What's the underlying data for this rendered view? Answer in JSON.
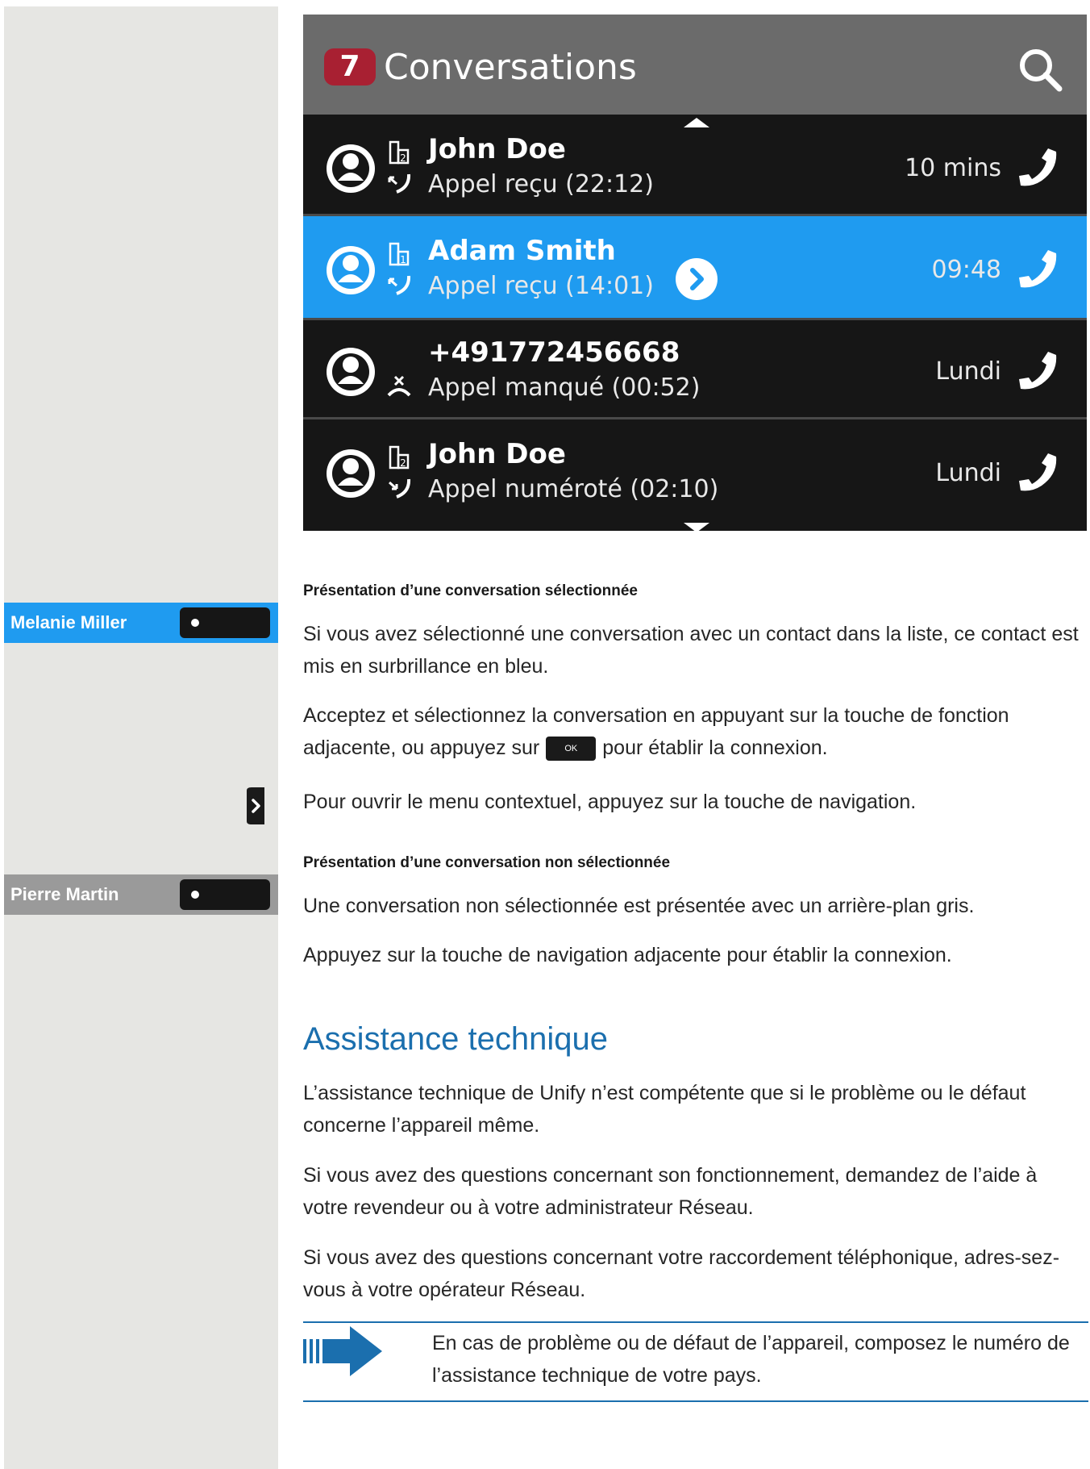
{
  "screen": {
    "badge_count": "7",
    "title": "Conversations",
    "search_icon": "search-icon",
    "conversations": [
      {
        "name": "John Doe",
        "status": "Appel reçu (22:12)",
        "time": "10 mins",
        "type_icon": "building-2-icon",
        "direction_icon": "incoming-call-icon",
        "selected": false
      },
      {
        "name": "Adam Smith",
        "status": "Appel reçu (14:01)",
        "time": "09:48",
        "type_icon": "building-1-icon",
        "direction_icon": "incoming-call-icon",
        "selected": true
      },
      {
        "name": "+491772456668",
        "status": "Appel manqué (00:52)",
        "time": "Lundi",
        "type_icon": "",
        "direction_icon": "missed-call-icon",
        "selected": false
      },
      {
        "name": "John Doe",
        "status": "Appel numéroté (02:10)",
        "time": "Lundi",
        "type_icon": "building-2-icon",
        "direction_icon": "outgoing-call-icon",
        "selected": false
      }
    ],
    "colors": {
      "header": "#6b6b6b",
      "list_bg": "#161616",
      "selected": "#1f9bf0",
      "badge": "#a82032"
    }
  },
  "side_keys": {
    "melanie": {
      "label": "Melanie Miller",
      "color": "#1f9bf0"
    },
    "pierre": {
      "label": "Pierre Martin",
      "color": "#9a9a9a"
    }
  },
  "doc": {
    "selected_heading": "Présentation d’une conversation sélectionnée",
    "selected_p1": "Si vous avez sélectionné une conversation avec un contact dans la liste, ce contact est mis en surbrillance en bleu.",
    "selected_p2_before": "Acceptez et sélectionnez la conversation en appuyant sur la touche de fonction adjacente, ou appuyez sur",
    "ok_key_label": "OK",
    "selected_p2_after": "pour établir la connexion.",
    "selected_p3": "Pour ouvrir le menu contextuel, appuyez sur la touche de navigation.",
    "unselected_heading": "Présentation d’une conversation non sélectionnée",
    "unselected_p1": "Une conversation non sélectionnée est présentée avec un arrière-plan gris.",
    "unselected_p2": "Appuyez sur la touche de navigation adjacente pour établir la connexion.",
    "support_heading": "Assistance technique",
    "support_p1": "L’assistance technique de Unify n’est compétente que si le problème ou le défaut concerne l’appareil même.",
    "support_p2": "Si vous avez des questions concernant son fonctionnement, demandez de l’aide à votre revendeur ou à votre administrateur Réseau.",
    "support_p3": "Si vous avez des questions concernant votre raccordement téléphonique, adres-sez-vous à votre opérateur Réseau.",
    "note_text": "En cas de problème ou de défaut de l’appareil, composez le numéro de l’assistance technique de votre pays.",
    "accent_color": "#1b6fae"
  }
}
